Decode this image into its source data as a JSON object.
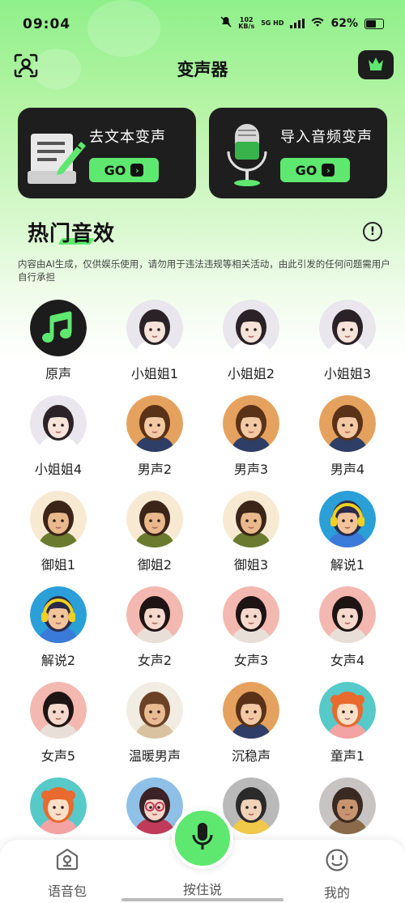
{
  "status_bar": {
    "time": "09:04",
    "speed_value": "102",
    "speed_unit": "KB/s",
    "network": "5G HD",
    "battery": "62%"
  },
  "header": {
    "title": "变声器",
    "left_icon": "profile-scan-icon",
    "right_icon": "crown-icon"
  },
  "cards": [
    {
      "label": "去文本变声",
      "button": "GO",
      "icon": "document-pen-icon"
    },
    {
      "label": "导入音频变声",
      "button": "GO",
      "icon": "microphone-stand-icon"
    }
  ],
  "section": {
    "title": "热门音效",
    "disclaimer": "内容由AI生成，仅供娱乐使用，请勿用于违法违规等相关活动，由此引发的任何问题需用户自行承担",
    "info_icon": "!"
  },
  "voices": [
    {
      "label": "原声",
      "avatar": "music-note"
    },
    {
      "label": "小姐姐1",
      "avatar": "girl"
    },
    {
      "label": "小姐姐2",
      "avatar": "girl"
    },
    {
      "label": "小姐姐3",
      "avatar": "girl"
    },
    {
      "label": "小姐姐4",
      "avatar": "girl"
    },
    {
      "label": "男声2",
      "avatar": "man"
    },
    {
      "label": "男声3",
      "avatar": "man"
    },
    {
      "label": "男声4",
      "avatar": "man"
    },
    {
      "label": "御姐1",
      "avatar": "lady"
    },
    {
      "label": "御姐2",
      "avatar": "lady"
    },
    {
      "label": "御姐3",
      "avatar": "lady"
    },
    {
      "label": "解说1",
      "avatar": "narrator"
    },
    {
      "label": "解说2",
      "avatar": "narrator"
    },
    {
      "label": "女声2",
      "avatar": "woman"
    },
    {
      "label": "女声3",
      "avatar": "woman"
    },
    {
      "label": "女声4",
      "avatar": "woman"
    },
    {
      "label": "女声5",
      "avatar": "woman"
    },
    {
      "label": "温暖男声",
      "avatar": "warm-man"
    },
    {
      "label": "沉稳声",
      "avatar": "man"
    },
    {
      "label": "童声1",
      "avatar": "child"
    },
    {
      "label": "",
      "avatar": "child"
    },
    {
      "label": "",
      "avatar": "glasses-girl"
    },
    {
      "label": "",
      "avatar": "boy"
    },
    {
      "label": "",
      "avatar": "curly-man"
    }
  ],
  "bottom_nav": {
    "left": {
      "label": "语音包",
      "icon": "voice-pack-icon"
    },
    "center": {
      "label": "按住说",
      "icon": "microphone-icon"
    },
    "right": {
      "label": "我的",
      "icon": "smiley-icon"
    }
  },
  "colors": {
    "accent": "#5ee86f",
    "card_bg": "#1e1e1e",
    "header_green": "#8ff08a"
  }
}
